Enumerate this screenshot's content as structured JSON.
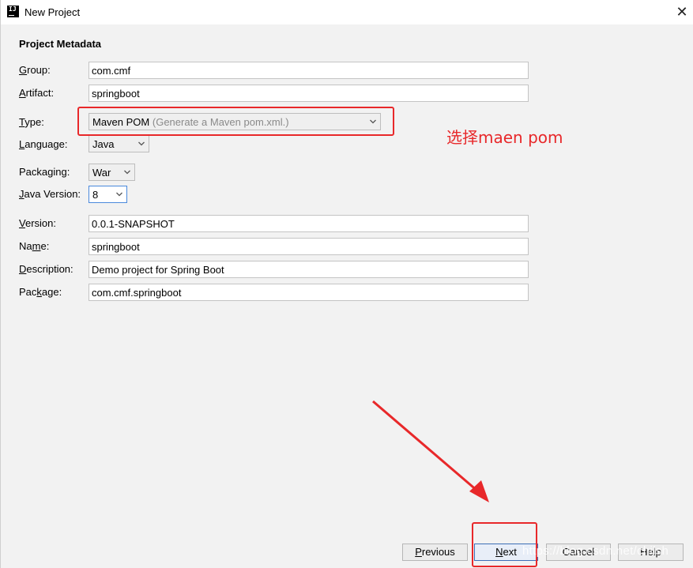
{
  "window": {
    "title": "New Project",
    "app_icon_text": "IJ"
  },
  "section_title": "Project Metadata",
  "fields": {
    "group": {
      "label": "Group:",
      "mnemonic": "G",
      "rest": "roup:",
      "value": "com.cmf"
    },
    "artifact": {
      "label": "Artifact:",
      "mnemonic": "A",
      "rest": "rtifact:",
      "value": "springboot"
    },
    "type": {
      "label": "Type:",
      "mnemonic": "T",
      "rest": "ype:",
      "value": "Maven POM",
      "hint": "(Generate a Maven pom.xml.)"
    },
    "language": {
      "label": "Language:",
      "mnemonic": "L",
      "rest": "anguage:",
      "value": "Java"
    },
    "packaging": {
      "label": "Packaging:",
      "value": "War"
    },
    "java_version": {
      "label": "Java Version:",
      "mnemonic": "J",
      "rest": "ava Version:",
      "value": "8"
    },
    "version": {
      "label": "Version:",
      "mnemonic": "V",
      "rest": "ersion:",
      "value": "0.0.1-SNAPSHOT"
    },
    "name": {
      "label": "Name:",
      "pre": "Na",
      "mnemonic": "m",
      "rest": "e:",
      "value": "springboot"
    },
    "description": {
      "label": "Description:",
      "mnemonic": "D",
      "rest": "escription:",
      "value": "Demo project for Spring Boot"
    },
    "package": {
      "label": "Package:",
      "pre": "Pac",
      "mnemonic": "k",
      "rest": "age:",
      "value": "com.cmf.springboot"
    }
  },
  "buttons": {
    "previous": {
      "mnemonic": "P",
      "rest": "revious"
    },
    "next": {
      "mnemonic": "N",
      "rest": "ext"
    },
    "cancel": {
      "label": "Cancel"
    },
    "help": {
      "label": "Help"
    }
  },
  "annotation_text": "选择maen pom",
  "watermark_text": "https://blog.csdn.net/chilsh",
  "colors": {
    "annotation_red": "#e8282a",
    "focus_blue": "#4a89dc"
  }
}
